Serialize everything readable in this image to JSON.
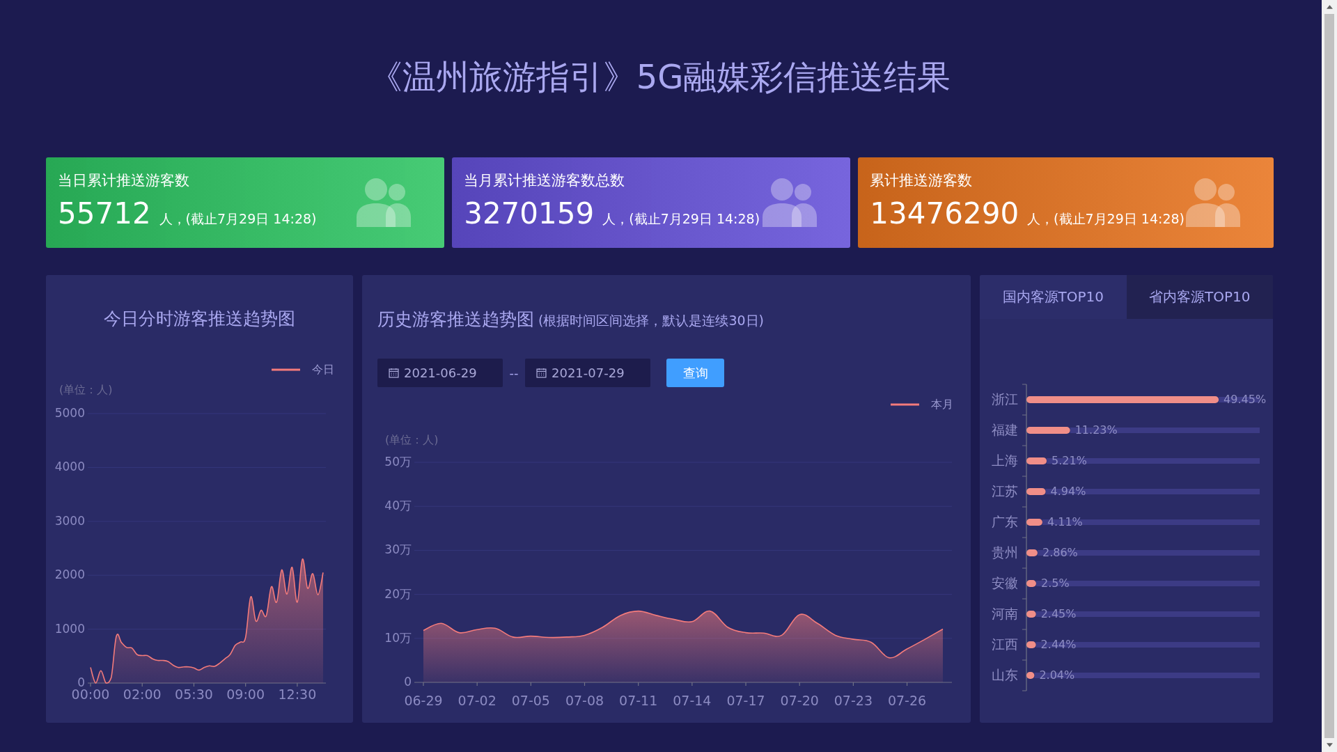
{
  "title": "《温州旅游指引》5G融媒彩信推送结果",
  "cards": [
    {
      "title": "当日累计推送游客数",
      "value": "55712",
      "suffix": "人，(截止7月29日 14:28)",
      "color": "#2dc462"
    },
    {
      "title": "当月累计推送游客数总数",
      "value": "3270159",
      "suffix": "人，(截止7月29日 14:28)",
      "color": "#6450d8"
    },
    {
      "title": "累计推送游客数",
      "value": "13476290",
      "suffix": "人，(截止7月29日 14:28)",
      "color": "#e8741f"
    }
  ],
  "today_panel": {
    "title": "今日分时游客推送趋势图",
    "chart_data": {
      "type": "area",
      "ylabel": "(单位：人)",
      "ylim": [
        0,
        5000
      ],
      "yticks": [
        0,
        1000,
        2000,
        3000,
        4000,
        5000
      ],
      "grid": true,
      "categories": [
        "00:00",
        null,
        null,
        null,
        null,
        null,
        null,
        null,
        null,
        null,
        "02:00",
        null,
        null,
        null,
        null,
        null,
        null,
        null,
        null,
        null,
        "05:30",
        null,
        null,
        null,
        null,
        null,
        null,
        null,
        null,
        null,
        "09:00",
        null,
        null,
        null,
        null,
        null,
        null,
        null,
        null,
        null,
        "12:30",
        null,
        null,
        null,
        null,
        null
      ],
      "series": [
        {
          "name": "今日",
          "color": "#f47b7b",
          "values": [
            290,
            0,
            230,
            0,
            100,
            870,
            750,
            660,
            650,
            530,
            510,
            510,
            450,
            420,
            420,
            400,
            330,
            290,
            300,
            300,
            280,
            240,
            290,
            320,
            310,
            370,
            450,
            530,
            700,
            760,
            850,
            1600,
            1150,
            1350,
            1250,
            1790,
            1500,
            2100,
            1650,
            2150,
            1500,
            2300,
            1760,
            2030,
            1640,
            2050
          ]
        }
      ]
    }
  },
  "history_panel": {
    "title": "历史游客推送趋势图",
    "note": "(根据时间区间选择，默认是连续30日)",
    "start_date": "2021-06-29",
    "separator": "--",
    "end_date": "2021-07-29",
    "query_button": "查询",
    "chart_data": {
      "type": "area",
      "ylabel": "(单位：人)",
      "ylim": [
        0,
        50
      ],
      "grid": true,
      "yticks": [
        {
          "value": 0,
          "label": "0"
        },
        {
          "value": 10,
          "label": "10万"
        },
        {
          "value": 20,
          "label": "20万"
        },
        {
          "value": 30,
          "label": "30万"
        },
        {
          "value": 40,
          "label": "40万"
        },
        {
          "value": 50,
          "label": "50万"
        }
      ],
      "categories": [
        "06-29",
        null,
        null,
        "07-02",
        null,
        null,
        "07-05",
        null,
        null,
        "07-08",
        null,
        null,
        "07-11",
        null,
        null,
        "07-14",
        null,
        null,
        "07-17",
        null,
        null,
        "07-20",
        null,
        null,
        "07-23",
        null,
        null,
        "07-26",
        null,
        null
      ],
      "series": [
        {
          "name": "本月",
          "color": "#f47b7b",
          "values": [
            11.8,
            13.4,
            11.3,
            12.0,
            12.3,
            10.3,
            10.5,
            10.2,
            10.3,
            10.7,
            12.5,
            15.2,
            16.2,
            15.2,
            14.3,
            13.8,
            16.2,
            12.5,
            11.3,
            11.2,
            10.7,
            15.4,
            13.4,
            10.7,
            9.8,
            9.1,
            5.6,
            7.6,
            9.8,
            12.1
          ]
        }
      ]
    }
  },
  "source_panel": {
    "tabs": [
      {
        "label": "国内客源TOP10",
        "selected": true
      },
      {
        "label": "省内客源TOP10",
        "selected": false
      }
    ],
    "chart_data": {
      "type": "bar",
      "orientation": "horizontal",
      "xlim": [
        0,
        60
      ],
      "categories": [
        "浙江",
        "福建",
        "上海",
        "江苏",
        "广东",
        "贵州",
        "安徽",
        "河南",
        "江西",
        "山东"
      ],
      "values": [
        49.45,
        11.23,
        5.21,
        4.94,
        4.11,
        2.86,
        2.5,
        2.45,
        2.44,
        2.04
      ],
      "value_labels": [
        "49.45%",
        "11.23%",
        "5.21%",
        "4.94%",
        "4.11%",
        "2.86%",
        "2.5%",
        "2.45%",
        "2.44%",
        "2.04%"
      ]
    }
  }
}
